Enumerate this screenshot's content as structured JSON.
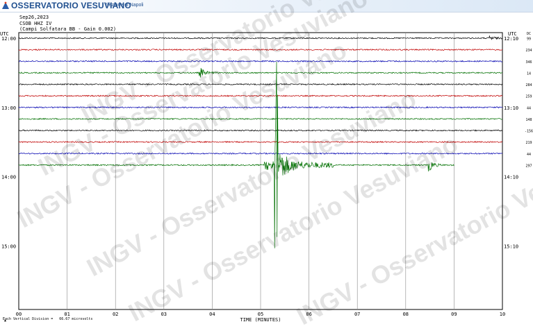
{
  "header": {
    "brand": "OSSERVATORIO VESUVIANO",
    "section": "Sezione di Napoli",
    "date": "Sep26,2023",
    "station": "CSOB HHZ IV",
    "station_desc": "(Campi Solfatara BB - Gain 0.002)"
  },
  "watermark": "INGV - Osservatorio Vesuviano",
  "footer_note": "Each Vertical Division =   66.67 microvolts",
  "colors": {
    "black": "#000000",
    "red": "#c00000",
    "blue": "#0000b0",
    "green": "#007000",
    "grid": "#888888"
  },
  "chart_data": {
    "type": "line",
    "title": "",
    "xlabel": "TIME (MINUTES)",
    "ylabel": "",
    "xlim": [
      0,
      10
    ],
    "x_ticks": [
      "00",
      "01",
      "02",
      "03",
      "04",
      "05",
      "06",
      "07",
      "08",
      "09",
      "10"
    ],
    "left_axis": {
      "label": "UTC",
      "ticks": [
        {
          "row": 0,
          "label": "12:00"
        },
        {
          "row": 6,
          "label": "13:00"
        },
        {
          "row": 12,
          "label": "14:00"
        },
        {
          "row": 18,
          "label": "15:00"
        }
      ]
    },
    "right_axis": {
      "label": "UTC",
      "ticks": [
        {
          "row": 0,
          "label": "12:10"
        },
        {
          "row": 6,
          "label": "13:10"
        },
        {
          "row": 12,
          "label": "14:10"
        },
        {
          "row": 18,
          "label": "15:10"
        }
      ]
    },
    "dc_header": "DC",
    "rows_total": 24,
    "series": [
      {
        "row": 0,
        "color": "black",
        "dc": "99",
        "events": [
          {
            "minute": 9.75,
            "amp": 0.35
          }
        ]
      },
      {
        "row": 1,
        "color": "red",
        "dc": "234",
        "events": []
      },
      {
        "row": 2,
        "color": "blue",
        "dc": "346",
        "events": []
      },
      {
        "row": 3,
        "color": "green",
        "dc": "14",
        "events": [
          {
            "minute": 3.75,
            "amp": 0.8
          }
        ]
      },
      {
        "row": 4,
        "color": "black",
        "dc": "284",
        "events": []
      },
      {
        "row": 5,
        "color": "red",
        "dc": "259",
        "events": []
      },
      {
        "row": 6,
        "color": "blue",
        "dc": "44",
        "events": []
      },
      {
        "row": 7,
        "color": "green",
        "dc": "148",
        "events": []
      },
      {
        "row": 8,
        "color": "black",
        "dc": "-156",
        "events": []
      },
      {
        "row": 9,
        "color": "red",
        "dc": "219",
        "events": []
      },
      {
        "row": 10,
        "color": "blue",
        "dc": "44",
        "events": []
      },
      {
        "row": 11,
        "color": "green",
        "dc": "297",
        "end_minute": 9.0,
        "events": [
          {
            "minute": 5.32,
            "amp": 30,
            "big": true
          },
          {
            "minute": 8.48,
            "amp": 1.0
          }
        ]
      }
    ]
  }
}
